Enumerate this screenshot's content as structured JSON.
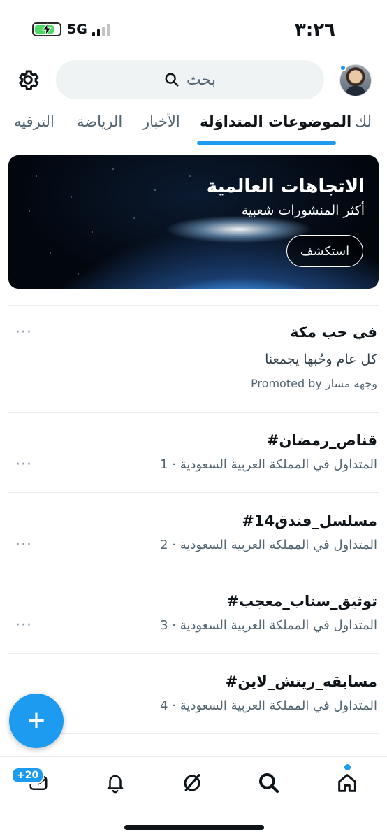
{
  "status_bar": {
    "time": "٣:٢٦",
    "network": "5G"
  },
  "search": {
    "placeholder": "بحث"
  },
  "tabs": [
    {
      "label": "لك"
    },
    {
      "label": "الموضوعات المتداوَلة"
    },
    {
      "label": "الأخبار"
    },
    {
      "label": "الرياضة"
    },
    {
      "label": "الترفيه"
    }
  ],
  "banner": {
    "title": "الاتجاهات العالمية",
    "subtitle": "أكثر المنشورات شعبية",
    "button": "استكشف"
  },
  "promoted": {
    "title": "في حب مكة",
    "text": "كل عام وحُبها يجمعنا",
    "meta": "Promoted by وجهة مسار",
    "more": "···"
  },
  "trends": [
    {
      "title": "#قناص_رمضان",
      "sub": "1 · المتداول في المملكة العربية السعودية",
      "more": "···"
    },
    {
      "title": "#مسلسل_فندق14",
      "sub": "2 · المتداول في المملكة العربية السعودية",
      "more": "···"
    },
    {
      "title": "#توثيق_سناب_معجب",
      "sub": "3 · المتداول في المملكة العربية السعودية",
      "more": "···"
    },
    {
      "title": "#مسابقه_ريتش_لاين",
      "sub": "4 · المتداول في المملكة العربية السعودية",
      "more": "···"
    }
  ],
  "fab": {
    "label": "+"
  },
  "bottom_nav": {
    "messages_badge": "+20"
  },
  "icons": {
    "gear": "gear-icon",
    "search": "search-icon",
    "home": "home-icon",
    "explore": "search-icon",
    "grok": "grok-icon",
    "notifications": "bell-icon",
    "messages": "mail-icon"
  },
  "colors": {
    "accent": "#1d9bf0",
    "text": "#0f1419",
    "muted": "#536471"
  }
}
